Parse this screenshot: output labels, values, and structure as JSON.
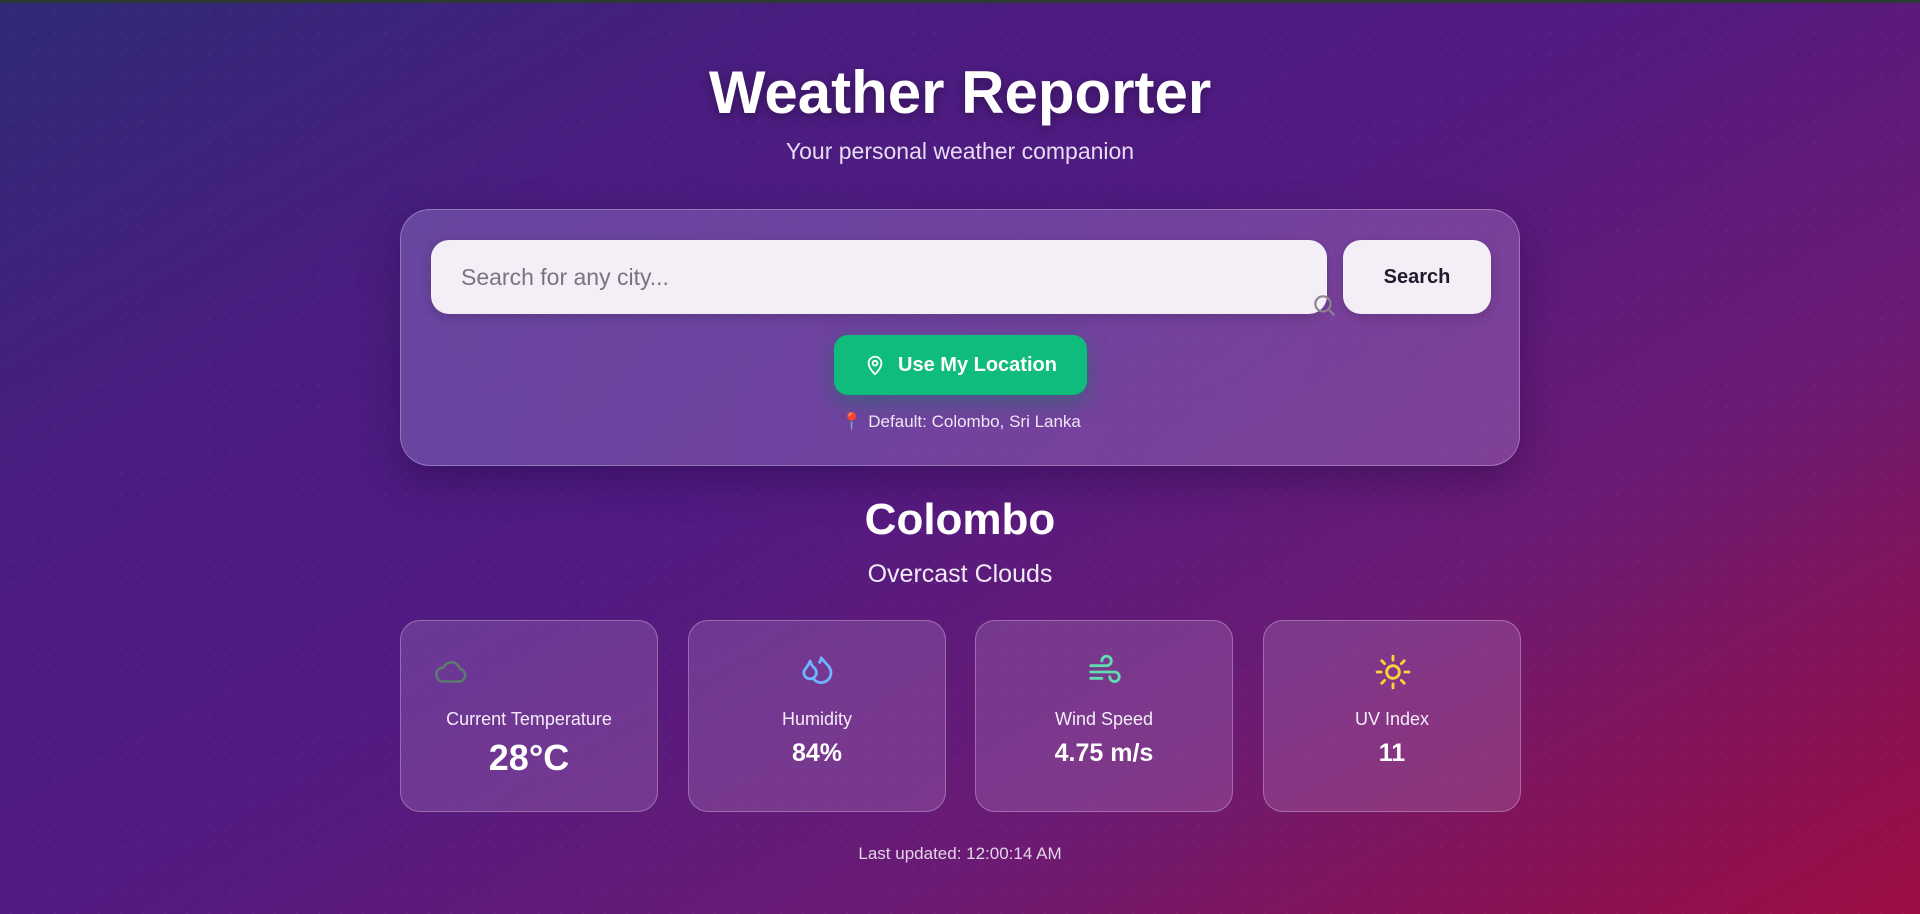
{
  "header": {
    "title": "Weather Reporter",
    "subtitle": "Your personal weather companion"
  },
  "search": {
    "placeholder": "Search for any city...",
    "value": "",
    "button_label": "Search",
    "icon": "search-icon"
  },
  "location": {
    "button_label": "Use My Location",
    "icon": "map-pin-icon",
    "default_text": "Default: Colombo, Sri Lanka",
    "default_icon": "📍"
  },
  "weather": {
    "city": "Colombo",
    "condition": "Overcast Clouds",
    "cards": [
      {
        "label": "Current Temperature",
        "value": "28°C",
        "icon": "cloud-icon",
        "icon_color": "#5c7a6e"
      },
      {
        "label": "Humidity",
        "value": "84%",
        "icon": "droplets-icon",
        "icon_color": "#6fb2ff"
      },
      {
        "label": "Wind Speed",
        "value": "4.75 m/s",
        "icon": "wind-icon",
        "icon_color": "#5fdcb0"
      },
      {
        "label": "UV Index",
        "value": "11",
        "icon": "sun-icon",
        "icon_color": "#ffd23a"
      }
    ]
  },
  "footer": {
    "last_updated": "Last updated: 12:00:14 AM"
  },
  "colors": {
    "accent_green": "#0fbc7c",
    "background_start": "#2f2a78",
    "background_end": "#9c0d44"
  }
}
